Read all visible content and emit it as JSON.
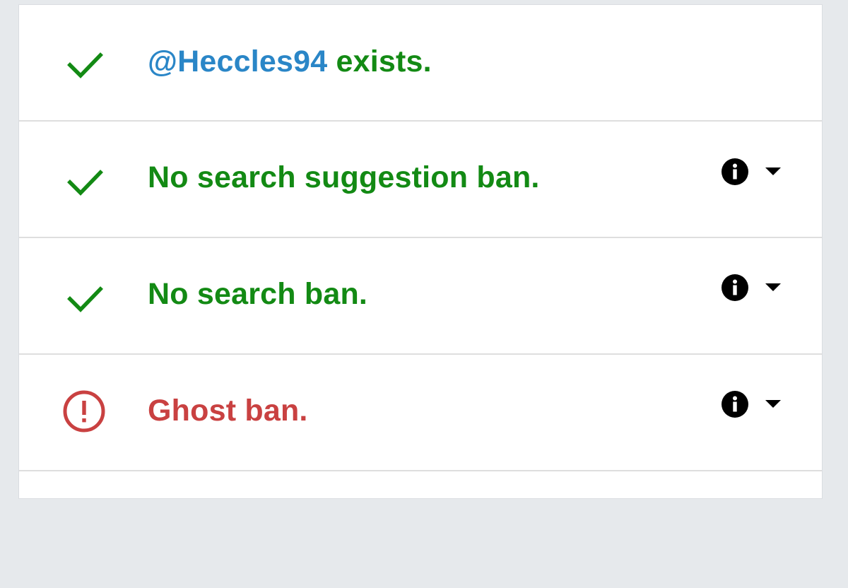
{
  "colors": {
    "ok": "#138a14",
    "bad": "#c94141",
    "link": "#2a86c7"
  },
  "results": [
    {
      "status": "ok",
      "icon": "checkmark-icon",
      "handle": "@Heccles94",
      "text": " exists.",
      "has_controls": false
    },
    {
      "status": "ok",
      "icon": "checkmark-icon",
      "text": "No search suggestion ban.",
      "has_controls": true
    },
    {
      "status": "ok",
      "icon": "checkmark-icon",
      "text": "No search ban.",
      "has_controls": true
    },
    {
      "status": "bad",
      "icon": "alert-circle-icon",
      "text": "Ghost ban.",
      "has_controls": true
    }
  ],
  "controls": {
    "info_icon": "info-icon",
    "expand_icon": "chevron-down-icon"
  }
}
